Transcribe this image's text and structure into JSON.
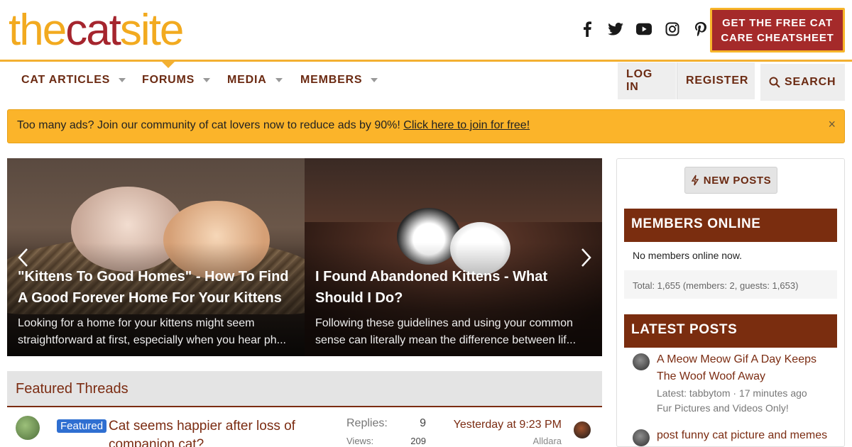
{
  "logo": {
    "part1": "the",
    "part2": "cat",
    "part3": "site"
  },
  "social": [
    {
      "icon": "facebook-icon",
      "glyph": "f"
    },
    {
      "icon": "twitter-icon",
      "glyph": "t"
    },
    {
      "icon": "youtube-icon",
      "glyph": "▶"
    },
    {
      "icon": "instagram-icon",
      "glyph": "◎"
    },
    {
      "icon": "pinterest-icon",
      "glyph": "p"
    }
  ],
  "cta": {
    "line1": "GET THE FREE CAT",
    "line2": "CARE CHEATSHEET"
  },
  "nav": {
    "items": [
      "CAT ARTICLES",
      "FORUMS",
      "MEDIA",
      "MEMBERS"
    ],
    "login": "LOG IN",
    "register": "REGISTER",
    "search": "SEARCH"
  },
  "banner": {
    "text": "Too many ads? Join our community of cat lovers now to reduce ads by 90%! ",
    "link": "Click here to join for free!",
    "close": "×"
  },
  "slides": [
    {
      "title": "\"Kittens To Good Homes\" - How To Find A Good Forever Home For Your Kittens",
      "desc": "Looking for a home for your kittens might seem straightforward at first, especially when you hear ph..."
    },
    {
      "title": "I Found Abandoned Kittens - What Should I Do?",
      "desc": "Following these guidelines and using your common sense can literally mean the difference between lif..."
    }
  ],
  "featured": {
    "heading": "Featured Threads",
    "thread": {
      "badge": "Featured",
      "title": "Cat seems happier after loss of companion cat?",
      "replies_label": "Replies:",
      "replies": "9",
      "views_label": "Views:",
      "views": "209",
      "latest": "Yesterday at 9:23 PM",
      "latest_user": "Alldara"
    }
  },
  "sidebar": {
    "new_posts": "NEW POSTS",
    "members_online": "MEMBERS ONLINE",
    "online_text": "No members online now.",
    "online_total": "Total: 1,655 (members: 2, guests: 1,653)",
    "latest_posts": "LATEST POSTS",
    "posts": [
      {
        "title": "A Meow Meow Gif A Day Keeps The Woof Woof Away",
        "meta": "Latest: tabbytom · 17 minutes ago",
        "forum": "Fur Pictures and Videos Only!"
      },
      {
        "title": "post funny cat picture and memes",
        "meta": "",
        "forum": ""
      }
    ]
  },
  "colors": {
    "brand_yellow": "#f3b031",
    "brand_red": "#a52a2a",
    "brand_brown": "#7a2d0f"
  }
}
